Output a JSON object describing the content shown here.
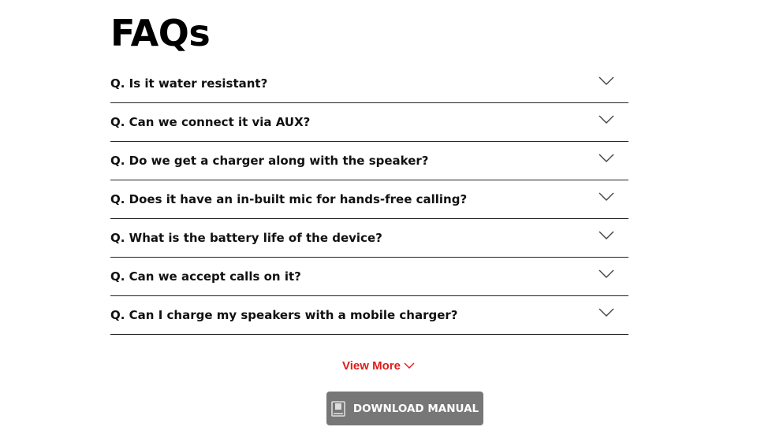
{
  "faq": {
    "title": "FAQs",
    "items": [
      {
        "question": "Q. Is it water resistant?"
      },
      {
        "question": "Q. Can we connect it via AUX?"
      },
      {
        "question": "Q. Do we get a charger along with the speaker?"
      },
      {
        "question": "Q. Does it have an in-built mic for hands-free calling?"
      },
      {
        "question": "Q. What is the battery life of the device?"
      },
      {
        "question": "Q. Can we accept calls on it?"
      },
      {
        "question": "Q. Can I charge my speakers with a mobile charger?"
      }
    ],
    "view_more_label": "View More",
    "download_label": "DOWNLOAD MANUAL"
  },
  "icons": {
    "expand": "chevron-down-icon",
    "view_more": "chevron-down-icon",
    "download": "book-icon"
  },
  "colors": {
    "accent": "#e01b1b",
    "button_bg": "#777777",
    "text": "#111111",
    "divider": "#222222"
  }
}
